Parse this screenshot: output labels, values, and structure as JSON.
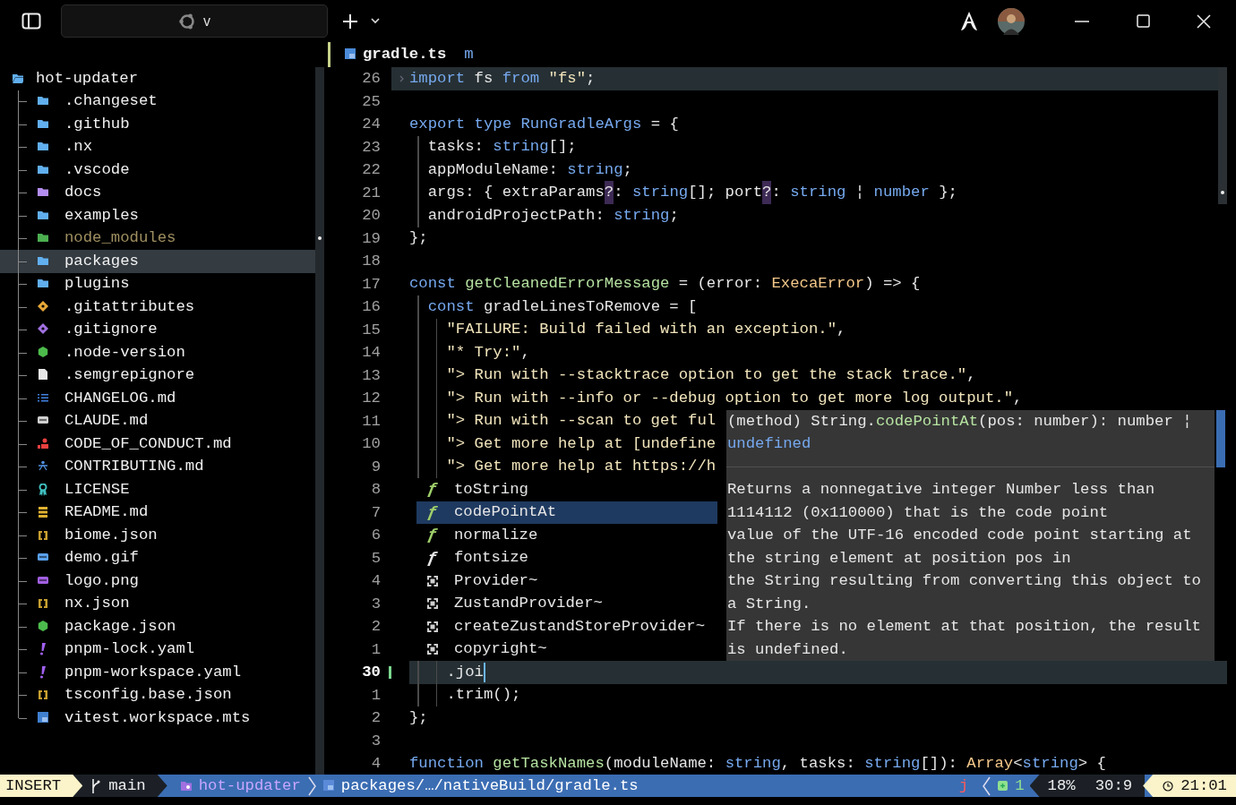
{
  "titlebar": {
    "tab_label": "v"
  },
  "sidebar": {
    "root": {
      "name": "hot-updater",
      "kind": "folder-open",
      "color": "#61afef",
      "selected": false,
      "ignored": false,
      "children": [
        {
          "name": ".changeset",
          "kind": "folder",
          "color": "#61afef",
          "selected": false,
          "ignored": false
        },
        {
          "name": ".github",
          "kind": "folder",
          "color": "#61afef",
          "selected": false,
          "ignored": false
        },
        {
          "name": ".nx",
          "kind": "folder",
          "color": "#61afef",
          "selected": false,
          "ignored": false
        },
        {
          "name": ".vscode",
          "kind": "folder",
          "color": "#61afef",
          "selected": false,
          "ignored": false
        },
        {
          "name": "docs",
          "kind": "folder",
          "color": "#b48ef0",
          "selected": false,
          "ignored": false
        },
        {
          "name": "examples",
          "kind": "folder",
          "color": "#61afef",
          "selected": false,
          "ignored": false
        },
        {
          "name": "node_modules",
          "kind": "folder",
          "color": "#4caf50",
          "selected": false,
          "ignored": true
        },
        {
          "name": "packages",
          "kind": "folder",
          "color": "#61afef",
          "selected": true,
          "ignored": false
        },
        {
          "name": "plugins",
          "kind": "folder",
          "color": "#61afef",
          "selected": false,
          "ignored": false
        },
        {
          "name": ".gitattributes",
          "kind": "diamond",
          "color": "#e8a838",
          "selected": false,
          "ignored": false
        },
        {
          "name": ".gitignore",
          "kind": "diamond",
          "color": "#a070e0",
          "selected": false,
          "ignored": false
        },
        {
          "name": ".node-version",
          "kind": "hexagon",
          "color": "#4cbb4c",
          "selected": false,
          "ignored": false
        },
        {
          "name": ".semgrepignore",
          "kind": "file",
          "color": "#e8e8e8",
          "selected": false,
          "ignored": false
        },
        {
          "name": "CHANGELOG.md",
          "kind": "list",
          "color": "#4080e0",
          "selected": false,
          "ignored": false
        },
        {
          "name": "CLAUDE.md",
          "kind": "badge",
          "color": "#d0d0d0",
          "selected": false,
          "ignored": false
        },
        {
          "name": "CODE_OF_CONDUCT.md",
          "kind": "person",
          "color": "#e84040",
          "selected": false,
          "ignored": false
        },
        {
          "name": "CONTRIBUTING.md",
          "kind": "people",
          "color": "#5090e0",
          "selected": false,
          "ignored": false
        },
        {
          "name": "LICENSE",
          "kind": "ribbon",
          "color": "#40c0c0",
          "selected": false,
          "ignored": false
        },
        {
          "name": "README.md",
          "kind": "book",
          "color": "#e0b030",
          "selected": false,
          "ignored": false
        },
        {
          "name": "biome.json",
          "kind": "braces",
          "color": "#c8a030",
          "selected": false,
          "ignored": false
        },
        {
          "name": "demo.gif",
          "kind": "badge",
          "color": "#5aa0f0",
          "selected": false,
          "ignored": false
        },
        {
          "name": "logo.png",
          "kind": "badge",
          "color": "#a060e0",
          "selected": false,
          "ignored": false
        },
        {
          "name": "nx.json",
          "kind": "braces",
          "color": "#c8a030",
          "selected": false,
          "ignored": false
        },
        {
          "name": "package.json",
          "kind": "hexagon",
          "color": "#4cbb4c",
          "selected": false,
          "ignored": false
        },
        {
          "name": "pnpm-lock.yaml",
          "kind": "exclaim",
          "color": "#a060f0",
          "selected": false,
          "ignored": false
        },
        {
          "name": "pnpm-workspace.yaml",
          "kind": "exclaim",
          "color": "#a060f0",
          "selected": false,
          "ignored": false
        },
        {
          "name": "tsconfig.base.json",
          "kind": "braces",
          "color": "#c8a030",
          "selected": false,
          "ignored": false
        },
        {
          "name": "vitest.workspace.mts",
          "kind": "ts",
          "color": "#4080d0",
          "selected": false,
          "ignored": false
        }
      ]
    }
  },
  "editor": {
    "filename": "gradle.ts",
    "flag": "m",
    "lines": [
      {
        "number": "26",
        "kind": "sticky",
        "changed": false,
        "tokens": [
          {
            "kind": "kw",
            "s": "import"
          },
          {
            "kind": "plain",
            "s": " fs "
          },
          {
            "kind": "kw",
            "s": "from"
          },
          {
            "kind": "str",
            "s": " \"fs\""
          },
          {
            "kind": "plain",
            "s": ";"
          }
        ]
      },
      {
        "number": "25",
        "kind": "code",
        "changed": false
      },
      {
        "number": "24",
        "kind": "code",
        "changed": false,
        "tokens": [
          {
            "kind": "kw",
            "s": "export type RunGradleArgs"
          },
          {
            "kind": "plain",
            "s": " = {"
          }
        ]
      },
      {
        "number": "23",
        "kind": "code",
        "changed": false,
        "tokens": [
          {
            "kind": "plain",
            "s": "  tasks: "
          },
          {
            "kind": "type",
            "s": "string"
          },
          {
            "kind": "plain",
            "s": "[];"
          }
        ]
      },
      {
        "number": "22",
        "kind": "code",
        "changed": false,
        "tokens": [
          {
            "kind": "plain",
            "s": "  appModuleName: "
          },
          {
            "kind": "type",
            "s": "string"
          },
          {
            "kind": "plain",
            "s": ";"
          }
        ]
      },
      {
        "number": "21",
        "kind": "code",
        "changed": false,
        "tokens": [
          {
            "kind": "plain",
            "s": "  args: { extraParams"
          },
          {
            "kind": "op",
            "s": "?"
          },
          {
            "kind": "plain",
            "s": ": "
          },
          {
            "kind": "type",
            "s": "string"
          },
          {
            "kind": "plain",
            "s": "[]; port"
          },
          {
            "kind": "op",
            "s": "?"
          },
          {
            "kind": "plain",
            "s": ": "
          },
          {
            "kind": "type",
            "s": "string"
          },
          {
            "kind": "plain",
            "s": " ¦ "
          },
          {
            "kind": "type",
            "s": "number"
          },
          {
            "kind": "plain",
            "s": " };"
          }
        ]
      },
      {
        "number": "20",
        "kind": "code",
        "changed": false,
        "tokens": [
          {
            "kind": "plain",
            "s": "  androidProjectPath: "
          },
          {
            "kind": "type",
            "s": "string"
          },
          {
            "kind": "plain",
            "s": ";"
          }
        ]
      },
      {
        "number": "19",
        "kind": "code",
        "changed": false,
        "tokens": [
          {
            "kind": "plain",
            "s": "};"
          }
        ]
      },
      {
        "number": "18",
        "kind": "code",
        "changed": false
      },
      {
        "number": "17",
        "kind": "code",
        "changed": false,
        "tokens": [
          {
            "kind": "kw",
            "s": "const"
          },
          {
            "kind": "fn",
            "s": " getCleanedErrorMessage"
          },
          {
            "kind": "plain",
            "s": " = (error: "
          },
          {
            "kind": "cls",
            "s": "ExecaError"
          },
          {
            "kind": "plain",
            "s": ") => {"
          }
        ]
      },
      {
        "number": "16",
        "kind": "code",
        "changed": false,
        "tokens": [
          {
            "kind": "kw",
            "s": "  const"
          },
          {
            "kind": "plain",
            "s": " gradleLinesToRemove = ["
          }
        ]
      },
      {
        "number": "15",
        "kind": "code",
        "changed": false,
        "tokens": [
          {
            "kind": "str",
            "s": "    \"FAILURE: Build failed with an exception.\""
          },
          {
            "kind": "plain",
            "s": ","
          }
        ]
      },
      {
        "number": "14",
        "kind": "code",
        "changed": false,
        "tokens": [
          {
            "kind": "str",
            "s": "    \"* Try:\""
          },
          {
            "kind": "plain",
            "s": ","
          }
        ]
      },
      {
        "number": "13",
        "kind": "code",
        "changed": false,
        "tokens": [
          {
            "kind": "str",
            "s": "    \"> Run with --stacktrace option to get the stack trace.\""
          },
          {
            "kind": "plain",
            "s": ","
          }
        ]
      },
      {
        "number": "12",
        "kind": "code",
        "changed": false,
        "tokens": [
          {
            "kind": "str",
            "s": "    \"> Run with --info or --debug option to get more log output.\""
          },
          {
            "kind": "plain",
            "s": ","
          }
        ]
      },
      {
        "number": "11",
        "kind": "code",
        "changed": false,
        "tokens": [
          {
            "kind": "str",
            "s": "    \"> Run with --scan to get ful"
          }
        ]
      },
      {
        "number": "10",
        "kind": "code",
        "changed": false,
        "tokens": [
          {
            "kind": "str",
            "s": "    \"> Get more help at [undefine"
          }
        ]
      },
      {
        "number": "9",
        "kind": "code",
        "changed": false,
        "tokens": [
          {
            "kind": "str",
            "s": "    \"> Get more help at https://h"
          }
        ]
      },
      {
        "number": "8",
        "kind": "code",
        "changed": false
      },
      {
        "number": "7",
        "kind": "code",
        "changed": false
      },
      {
        "number": "6",
        "kind": "code",
        "changed": false
      },
      {
        "number": "5",
        "kind": "code",
        "changed": false
      },
      {
        "number": "4",
        "kind": "code",
        "changed": false
      },
      {
        "number": "3",
        "kind": "code",
        "changed": false
      },
      {
        "number": "2",
        "kind": "code",
        "changed": false
      },
      {
        "number": "1",
        "kind": "code",
        "changed": false
      },
      {
        "number": "30",
        "kind": "cursor",
        "changed": true,
        "tokens": [
          {
            "kind": "plain",
            "s": "    .joi"
          }
        ]
      },
      {
        "number": "1",
        "kind": "code",
        "changed": false,
        "tokens": [
          {
            "kind": "plain",
            "s": "    .trim();"
          }
        ]
      },
      {
        "number": "2",
        "kind": "code",
        "changed": false,
        "tokens": [
          {
            "kind": "plain",
            "s": "};"
          }
        ]
      },
      {
        "number": "3",
        "kind": "code",
        "changed": false
      },
      {
        "number": "4",
        "kind": "code",
        "changed": false,
        "tokens": [
          {
            "kind": "kw",
            "s": "function"
          },
          {
            "kind": "fn",
            "s": " getTaskNames"
          },
          {
            "kind": "plain",
            "s": "(moduleName: "
          },
          {
            "kind": "type",
            "s": "string"
          },
          {
            "kind": "plain",
            "s": ", tasks: "
          },
          {
            "kind": "type",
            "s": "string"
          },
          {
            "kind": "plain",
            "s": "[]): "
          },
          {
            "kind": "cls",
            "s": "Array"
          },
          {
            "kind": "plain",
            "s": "<"
          },
          {
            "kind": "type",
            "s": "string"
          },
          {
            "kind": "plain",
            "s": "> {"
          }
        ]
      }
    ]
  },
  "completion": {
    "items": [
      {
        "kind": "function",
        "icon": "ƒ",
        "color": "#9ece6a",
        "label": "toString",
        "selected": false
      },
      {
        "kind": "function",
        "icon": "ƒ",
        "color": "#9ece6a",
        "label": "codePointAt",
        "selected": true
      },
      {
        "kind": "function",
        "icon": "ƒ",
        "color": "#9ece6a",
        "label": "normalize",
        "selected": false
      },
      {
        "kind": "function",
        "icon": "ƒ",
        "color": "#e6e6e6",
        "label": "fontsize",
        "selected": false
      },
      {
        "kind": "snippet",
        "color": "#cfcfcf",
        "label": "Provider~",
        "selected": false
      },
      {
        "kind": "snippet",
        "color": "#cfcfcf",
        "label": "ZustandProvider~",
        "selected": false
      },
      {
        "kind": "snippet",
        "color": "#cfcfcf",
        "label": "createZustandStoreProvider~",
        "selected": false
      },
      {
        "kind": "snippet",
        "color": "#cfcfcf",
        "label": "copyright~",
        "selected": false
      }
    ],
    "doc": {
      "signature": [
        [
          {
            "kind": "plain",
            "s": "(method) String."
          },
          {
            "kind": "fn",
            "s": "codePointAt"
          },
          {
            "kind": "plain",
            "s": "(pos: number): number ¦"
          }
        ],
        [
          {
            "kind": "type",
            "s": "undefined"
          }
        ]
      ],
      "lines": [
        "Returns a nonnegative integer Number less than",
        "1114112 (0x110000) that is the code point",
        "value of the UTF-16 encoded code point starting at",
        "the string element at position pos in",
        "the String resulting from converting this object to",
        "a String.",
        "If there is no element at that position, the result",
        "is undefined."
      ]
    }
  },
  "status_bar": {
    "mode": "INSERT",
    "branch": "main",
    "project": "hot-updater",
    "path": "packages/…/nativeBuild/gradle.ts",
    "indicator": "j",
    "diagnostics": "1",
    "progress": "18%",
    "position": "30:9",
    "time": "21:01"
  }
}
